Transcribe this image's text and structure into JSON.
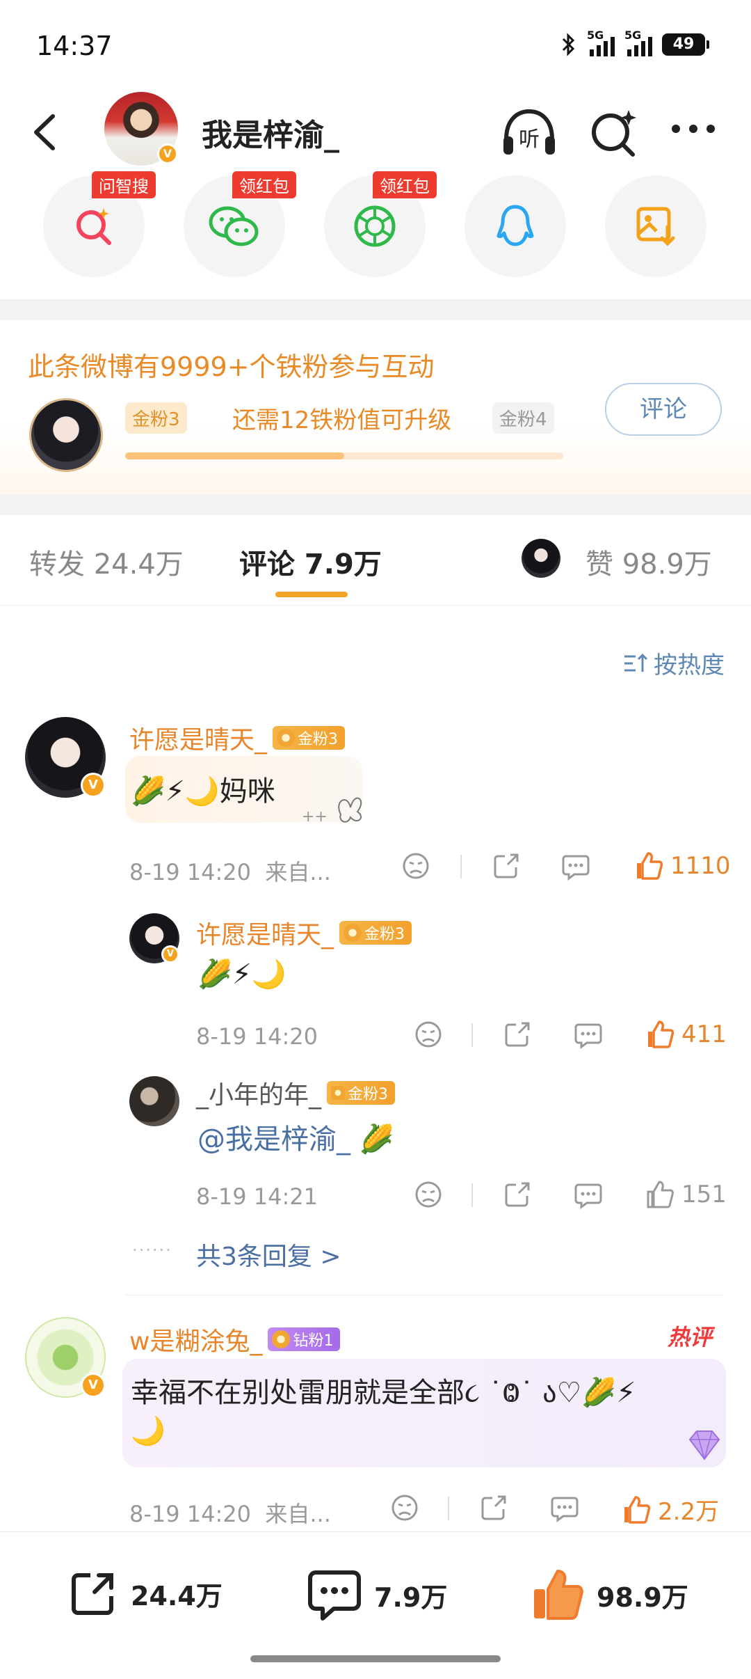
{
  "status_bar": {
    "time": "14:37",
    "network1": "5G",
    "network2": "5G",
    "battery": "49"
  },
  "header": {
    "username": "我是梓渝_",
    "listen_label": "听"
  },
  "quick_actions": [
    {
      "tag": "问智搜",
      "icon": "search-ai-icon",
      "color": "#f2445c"
    },
    {
      "tag": "领红包",
      "icon": "wechat-icon",
      "color": "#2fb94b"
    },
    {
      "tag": "领红包",
      "icon": "moments-icon",
      "color": "#2fb94b"
    },
    {
      "tag": "",
      "icon": "qq-icon",
      "color": "#2aa7f0"
    },
    {
      "tag": "",
      "icon": "save-image-icon",
      "color": "#f3a219"
    }
  ],
  "fan_card": {
    "title": "此条微博有9999+个铁粉参与互动",
    "current_level": "金粉3",
    "next_level": "金粉4",
    "need_text": "还需12铁粉值可升级",
    "progress": 0.5,
    "comment_button": "评论"
  },
  "tabs": {
    "repost": "转发 24.4万",
    "comment": "评论 7.9万",
    "like": "赞 98.9万"
  },
  "sort_label": "按热度",
  "comments": [
    {
      "user": "许愿是晴天_",
      "badge": "金粉3",
      "badge_level": "6",
      "text": "🌽⚡🌙妈咪",
      "time": "8-19 14:20",
      "source": "来自...",
      "likes": "1110",
      "replies": [
        {
          "user": "许愿是晴天_",
          "badge": "金粉3",
          "badge_level": "6",
          "text": "🌽⚡🌙",
          "time": "8-19 14:20",
          "likes": "411"
        },
        {
          "user": "_小年的年_",
          "badge": "金粉3",
          "text": "@我是梓渝_ 🌽",
          "time": "8-19 14:21",
          "likes": "151"
        }
      ],
      "more_replies": "共3条回复 >"
    },
    {
      "user": "w是糊涂兔_",
      "badge": "钻粉1",
      "badge_level": "6",
      "hot_tag": "热评",
      "text_line1": "幸福不在别处雷朋就是全部૮ ˙Ⱉ˙ ა♡🌽⚡",
      "text_line2": "🌙",
      "time": "8-19 14:20",
      "source": "来自...",
      "likes": "2.2万"
    }
  ],
  "bottom_bar": {
    "repost": "24.4万",
    "comment": "7.9万",
    "like": "98.9万"
  }
}
